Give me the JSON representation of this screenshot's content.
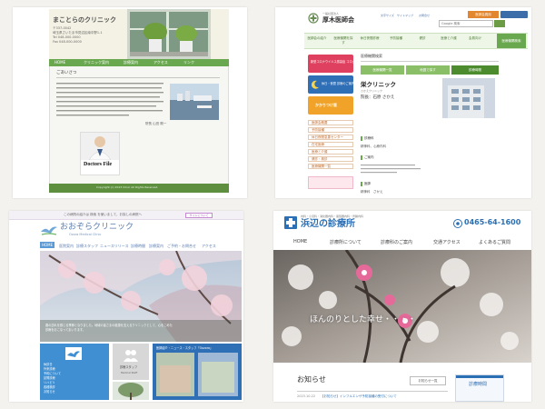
{
  "p1": {
    "clinic_name": "まことらのクリニック",
    "address_lines": [
      "〒337-0042",
      "埼玉県さいたま市見沼区南中野1-1",
      "Tel 048-000-0000",
      "Fax 048-000-0000"
    ],
    "nav": [
      "HOME",
      "クリニック案内",
      "診療案内",
      "アクセス",
      "リンク"
    ],
    "greeting_heading": "ごあいさつ",
    "director_sign": "院長 山田 剛一",
    "doctors_file_label": "Doctors File",
    "footer_text": "Copyright (c) 2013 Clinic All Rights Reserved."
  },
  "p2": {
    "assoc_kicker": "一般社団法人",
    "assoc_name": "厚木医師会",
    "header_links": [
      "文字サイズ",
      "サイトマップ",
      "お問合せ"
    ],
    "search_placeholder": "Google 検索",
    "member_button": "医師会員用",
    "menu": [
      "医師会の紹介",
      "医療機関を探す",
      "休日夜間診療",
      "予防接種",
      "健診",
      "医療と介護",
      "会員向け",
      "医療機関検索"
    ],
    "side_banner1": "新型コロナウイルス感染症 コロナ診療",
    "side_banner2": "休日・夜間 診療のご案内",
    "side_banner3": "かかりつけ医",
    "side_links": [
      "医師会概要",
      "予防接種",
      "休日夜間急患センター",
      "在宅医療",
      "医療と介護",
      "健診・検診",
      "医療機関一覧"
    ],
    "section_label": "医療機関検索",
    "tabs": [
      "医療機関一覧",
      "地図で探す",
      "診療時間"
    ],
    "clinic_title": "栄クリニック",
    "clinic_kana": "さかえクリニック",
    "doctor_label": "院長：石原 さかえ",
    "dept_heading": "診療科",
    "dept_text": "精神科、心療内科",
    "notice_heading": "ご案内",
    "staff_heading": "医師",
    "staff_text": "精神科　さかえ"
  },
  "p3": {
    "topbar_text": "この病院の紹介は 検索 を使いまして、お探しの病院へ",
    "topbar_button": "サイトについて",
    "clinic_name": "おおぞらクリニック",
    "clinic_sub": "Ozora Medical Clinic",
    "nav": [
      "HOME",
      "医院案内",
      "診療スタッフ",
      "ニュースリリース",
      "診療時間",
      "診療案内",
      "ご予約・お問合せ",
      "アクセス"
    ],
    "hero_caption": "春の訪れを感じる季節となりました。地域の皆さまの健康を支えるクリニックとして、心をこめた診療をおこなってまいります。",
    "card_staff": "診療スタッフ",
    "card_staff_en": "Medical Staff",
    "news_heading": "医師紹介・ニュース・スタッフ「Oozora」",
    "info_list": [
      "休診日",
      "外来診療",
      "予約について",
      "訪問診療",
      "リハビリ",
      "各種検診",
      "お知らせ"
    ]
  },
  "p4": {
    "tagline": "内科・小児科・消化器内科・循環器内科・胃腸内科",
    "clinic_name": "浜辺の診療所",
    "phone": "0465-64-1600",
    "nav": [
      "HOME",
      "診療所について",
      "診療科のご案内",
      "交通アクセス",
      "よくあるご質問"
    ],
    "hero_caption": "ほんのりとした幸せ・・・・",
    "news_heading": "お知らせ",
    "news_more": "お知らせ一覧",
    "news_date": "2023.10.22",
    "news_item": "【お知らせ】インフルエンザ予防接種の受付について",
    "hours_heading": "診療時間"
  }
}
